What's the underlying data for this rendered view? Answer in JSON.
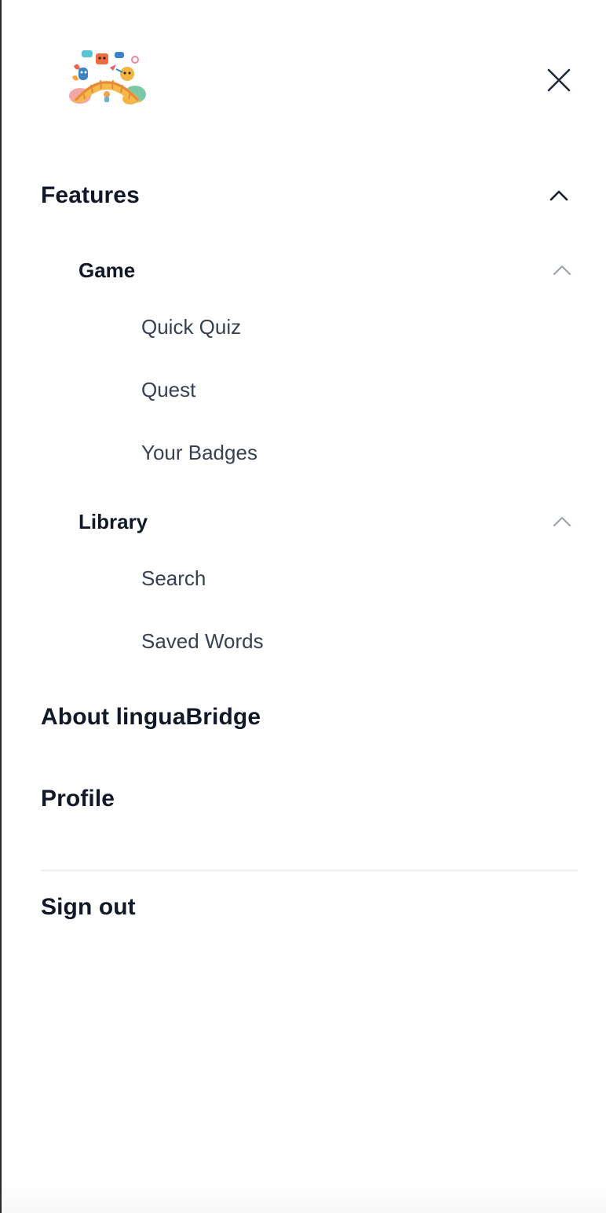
{
  "menu": {
    "features": {
      "label": "Features",
      "groups": {
        "game": {
          "label": "Game",
          "items": [
            "Quick Quiz",
            "Quest",
            "Your Badges"
          ]
        },
        "library": {
          "label": "Library",
          "items": [
            "Search",
            "Saved Words"
          ]
        }
      }
    },
    "about_label": "About linguaBridge",
    "profile_label": "Profile",
    "signout_label": "Sign out"
  },
  "icons": {
    "close": "close-icon",
    "expanded": "chevron-up-icon",
    "logo": "logo-illustration"
  },
  "colors": {
    "heading": "#111827",
    "leaf": "#374151",
    "chevron_sub": "#9ca3af",
    "divider": "#eceef1"
  }
}
